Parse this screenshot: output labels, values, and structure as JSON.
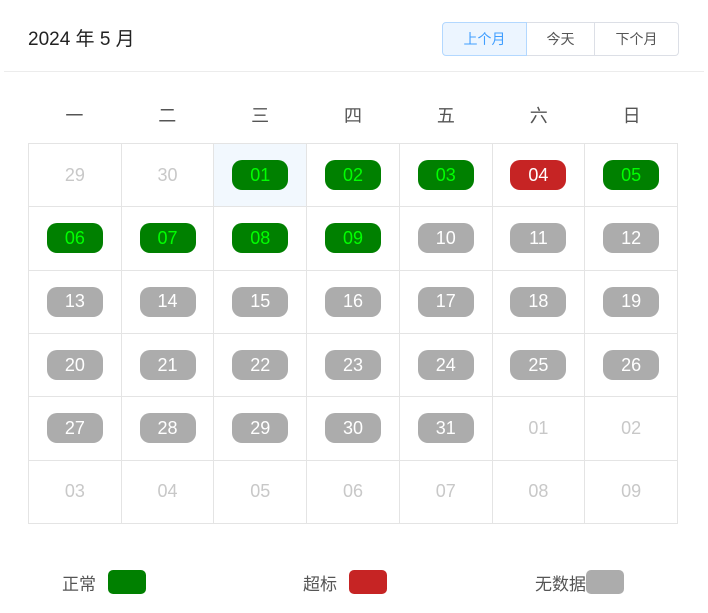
{
  "header": {
    "title": "2024 年 5 月",
    "buttons": {
      "prev": "上个月",
      "today": "今天",
      "next": "下个月"
    }
  },
  "weekdays": [
    "一",
    "二",
    "三",
    "四",
    "五",
    "六",
    "日"
  ],
  "selected_date": "01",
  "days": [
    {
      "label": "29",
      "status": "other"
    },
    {
      "label": "30",
      "status": "other"
    },
    {
      "label": "01",
      "status": "normal"
    },
    {
      "label": "02",
      "status": "normal"
    },
    {
      "label": "03",
      "status": "normal"
    },
    {
      "label": "04",
      "status": "over"
    },
    {
      "label": "05",
      "status": "normal"
    },
    {
      "label": "06",
      "status": "normal"
    },
    {
      "label": "07",
      "status": "normal"
    },
    {
      "label": "08",
      "status": "normal"
    },
    {
      "label": "09",
      "status": "normal"
    },
    {
      "label": "10",
      "status": "nodata"
    },
    {
      "label": "11",
      "status": "nodata"
    },
    {
      "label": "12",
      "status": "nodata"
    },
    {
      "label": "13",
      "status": "nodata"
    },
    {
      "label": "14",
      "status": "nodata"
    },
    {
      "label": "15",
      "status": "nodata"
    },
    {
      "label": "16",
      "status": "nodata"
    },
    {
      "label": "17",
      "status": "nodata"
    },
    {
      "label": "18",
      "status": "nodata"
    },
    {
      "label": "19",
      "status": "nodata"
    },
    {
      "label": "20",
      "status": "nodata"
    },
    {
      "label": "21",
      "status": "nodata"
    },
    {
      "label": "22",
      "status": "nodata"
    },
    {
      "label": "23",
      "status": "nodata"
    },
    {
      "label": "24",
      "status": "nodata"
    },
    {
      "label": "25",
      "status": "nodata"
    },
    {
      "label": "26",
      "status": "nodata"
    },
    {
      "label": "27",
      "status": "nodata"
    },
    {
      "label": "28",
      "status": "nodata"
    },
    {
      "label": "29",
      "status": "nodata"
    },
    {
      "label": "30",
      "status": "nodata"
    },
    {
      "label": "31",
      "status": "nodata"
    },
    {
      "label": "01",
      "status": "other"
    },
    {
      "label": "02",
      "status": "other"
    },
    {
      "label": "03",
      "status": "other"
    },
    {
      "label": "04",
      "status": "other"
    },
    {
      "label": "05",
      "status": "other"
    },
    {
      "label": "06",
      "status": "other"
    },
    {
      "label": "07",
      "status": "other"
    },
    {
      "label": "08",
      "status": "other"
    },
    {
      "label": "09",
      "status": "other"
    }
  ],
  "legend": [
    {
      "label": "正常",
      "color": "#008000"
    },
    {
      "label": "超标",
      "color": "#c62424"
    },
    {
      "label": "无数据",
      "color": "#acacac"
    }
  ],
  "colors": {
    "normal_bg": "#008000",
    "normal_text": "#00ff00",
    "over_bg": "#c62424",
    "nodata_bg": "#acacac",
    "other_month_text": "#c8c8c8",
    "accent": "#409eff"
  }
}
